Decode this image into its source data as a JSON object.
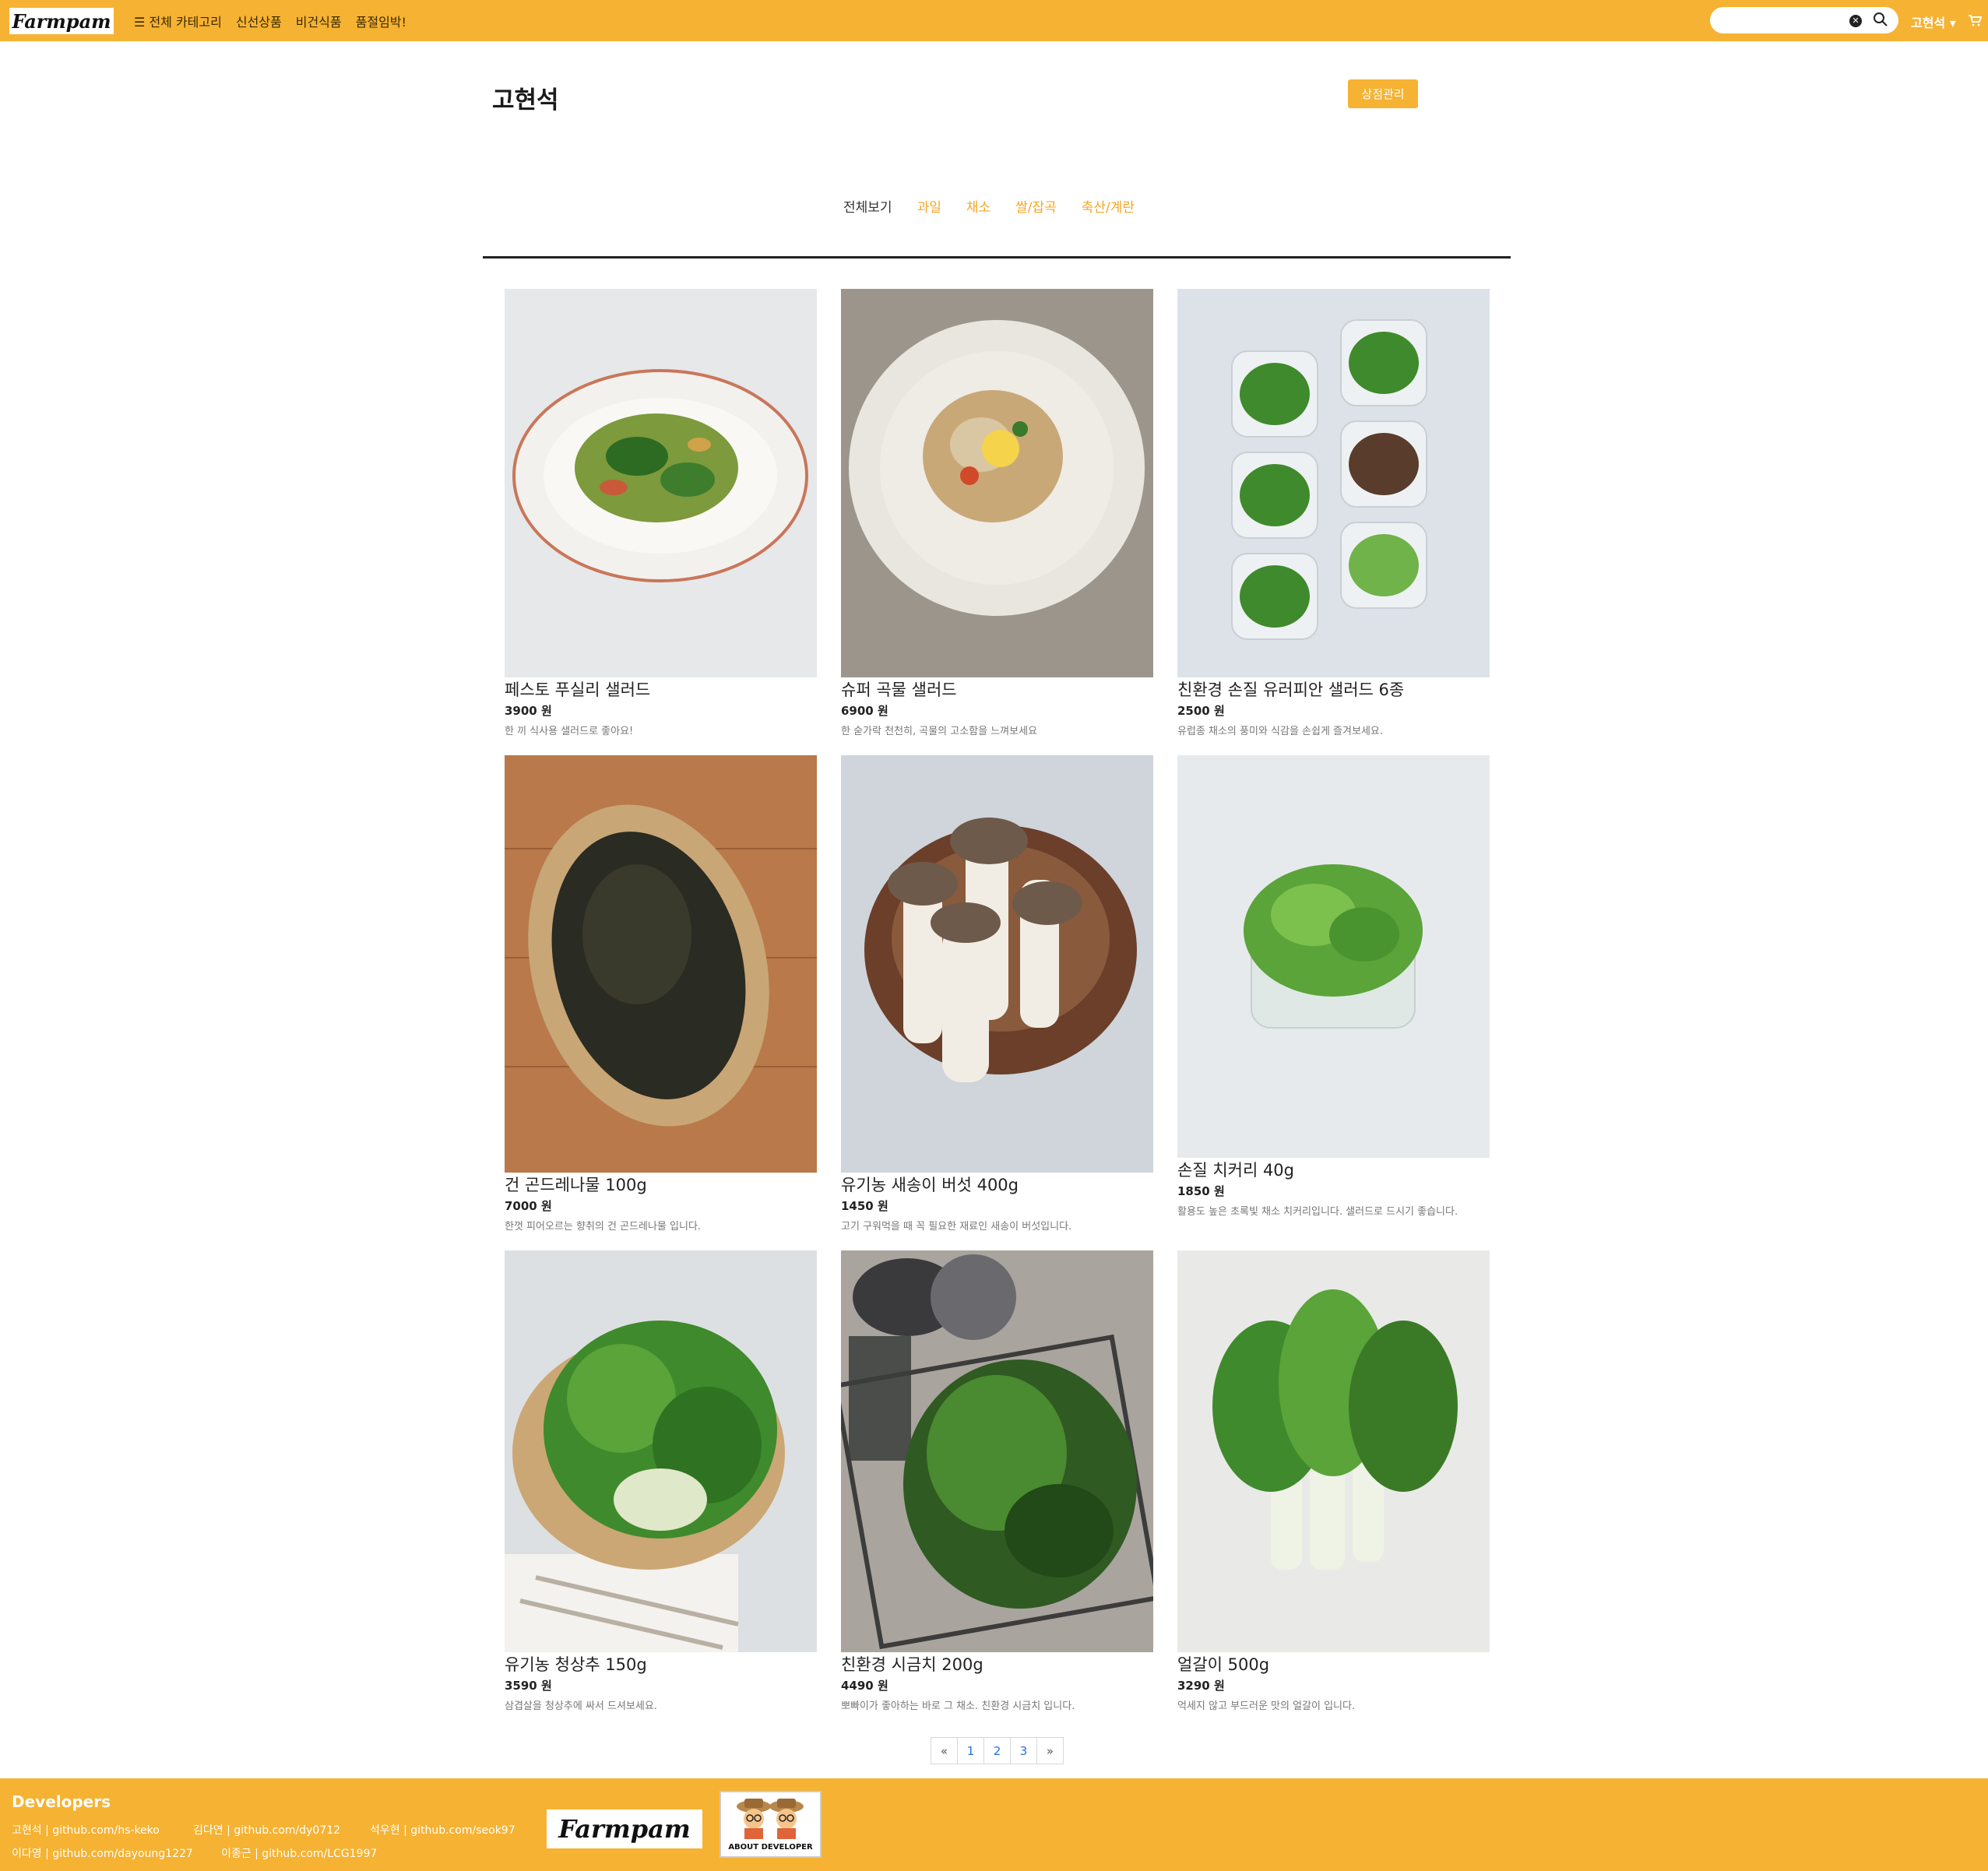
{
  "navbar": {
    "logo": "Farmpam",
    "menu_icon": "☰",
    "menu": [
      "전체 카테고리",
      "신선상품",
      "비건식품",
      "품절임박!"
    ],
    "search_placeholder": "",
    "user": "고현석 ▾",
    "colors": {
      "brand": "#f6b232"
    }
  },
  "store": {
    "title": "고현석",
    "manage_label": "상점관리"
  },
  "categories": [
    "전체보기",
    "과일",
    "채소",
    "쌀/잡곡",
    "축산/계란"
  ],
  "products": [
    {
      "name": "페스토 푸실리 샐러드",
      "price": "3900 원",
      "desc": "한 끼 식사용 샐러드로 좋아요!"
    },
    {
      "name": "슈퍼 곡물 샐러드",
      "price": "6900 원",
      "desc": "한 숟가락 천천히, 곡물의 고소함을 느껴보세요"
    },
    {
      "name": "친환경 손질 유러피안 샐러드 6종",
      "price": "2500 원",
      "desc": "유럽종 채소의 풍미와 식감을 손쉽게 즐겨보세요."
    },
    {
      "name": "건 곤드레나물 100g",
      "price": "7000 원",
      "desc": "한껏 피어오르는 향취의 건 곤드레나물 입니다."
    },
    {
      "name": "유기농 새송이 버섯 400g",
      "price": "1450 원",
      "desc": "고기 구워먹을 때 꼭 필요한 재료인 새송이 버섯입니다."
    },
    {
      "name": "손질 치커리 40g",
      "price": "1850 원",
      "desc": "활용도 높은 초록빛 채소 치커리입니다. 샐러드로 드시기 좋습니다."
    },
    {
      "name": "유기농 청상추 150g",
      "price": "3590 원",
      "desc": "삼겹살을 청상추에 싸서 드셔보세요."
    },
    {
      "name": "친환경 시금치 200g",
      "price": "4490 원",
      "desc": "뽀빠이가 좋아하는 바로 그 채소. 친환경 시금치 입니다."
    },
    {
      "name": "얼갈이 500g",
      "price": "3290 원",
      "desc": "억세지 않고 부드러운 맛의 얼갈이 입니다."
    }
  ],
  "pagination": {
    "prev": "«",
    "pages": [
      "1",
      "2",
      "3"
    ],
    "next": "»"
  },
  "footer": {
    "title": "Developers",
    "developers": [
      "고현석 | github.com/hs-keko",
      "김다연 | github.com/dy0712",
      "석우현 | github.com/seok97",
      "이다영 | github.com/dayoung1227",
      "이종근 | github.com/LCG1997"
    ],
    "logo": "Farmpam",
    "about_label": "ABOUT DEVELOPER"
  }
}
